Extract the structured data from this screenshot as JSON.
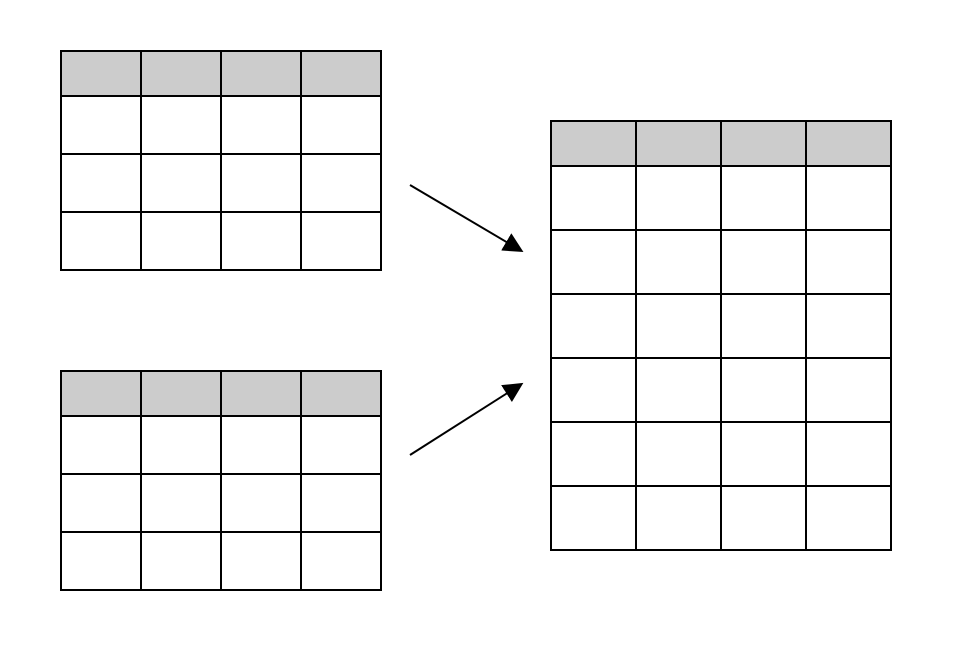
{
  "diagram": {
    "tables": {
      "source_top": {
        "columns": 4,
        "header_rows": 1,
        "data_rows": 3,
        "header_color": "#cccccc"
      },
      "source_bottom": {
        "columns": 4,
        "header_rows": 1,
        "data_rows": 3,
        "header_color": "#cccccc"
      },
      "destination": {
        "columns": 4,
        "header_rows": 1,
        "data_rows": 6,
        "header_color": "#cccccc"
      }
    },
    "arrows": [
      {
        "from": "source_top",
        "to": "destination"
      },
      {
        "from": "source_bottom",
        "to": "destination"
      }
    ]
  }
}
